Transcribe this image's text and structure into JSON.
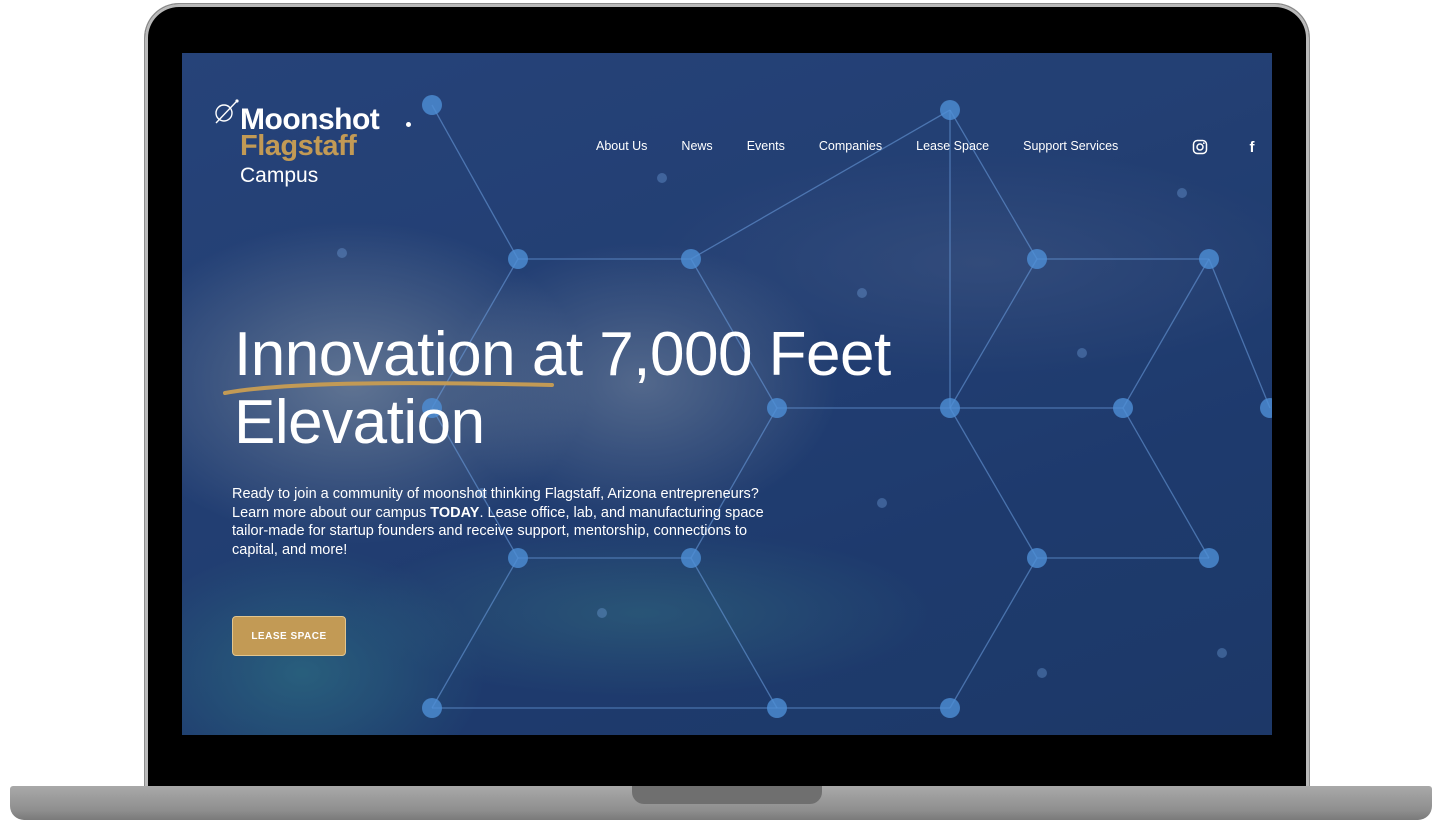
{
  "logo": {
    "line1": "Moonshot",
    "line2": "Flagstaff",
    "line3": "Campus",
    "icon": "planet-orbit-icon"
  },
  "nav": {
    "items": [
      {
        "label": "About Us"
      },
      {
        "label": "News"
      },
      {
        "label": "Events"
      },
      {
        "label": "Companies"
      },
      {
        "label": "Lease Space"
      },
      {
        "label": "Support Services"
      }
    ]
  },
  "social": {
    "instagram_icon": "instagram-icon",
    "facebook_icon": "facebook-icon",
    "facebook_glyph": "f"
  },
  "hero": {
    "title_line1": "Innovation at 7,000 Feet",
    "title_line2": "Elevation",
    "text_part1": "Ready to join a community of moonshot thinking Flagstaff, Arizona entrepreneurs?  Learn more about our campus ",
    "text_emphasis": "TODAY",
    "text_part2": ". Lease office, lab, and manufacturing space tailor-made for startup founders and receive support, mentorship, connections to capital, and more!",
    "cta_label": "LEASE SPACE"
  },
  "colors": {
    "accent_gold": "#c29a55",
    "screen_blue": "#264373",
    "network_node": "#4d8fd6"
  }
}
